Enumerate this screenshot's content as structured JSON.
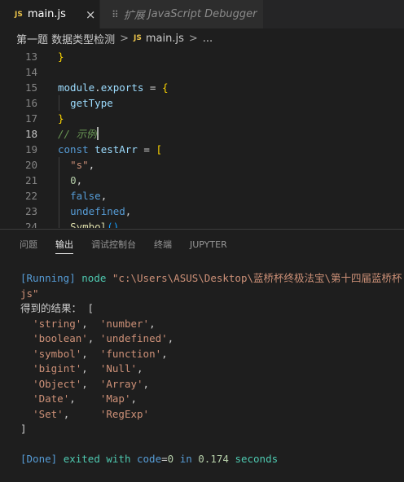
{
  "tabs": {
    "active": {
      "badge": "JS",
      "label": "main.js",
      "close": "×"
    },
    "inactive": {
      "icon": "⠿",
      "prefix": "扩展",
      "label": "JavaScript Debugger"
    }
  },
  "breadcrumb": {
    "folder": "第一题 数据类型检测",
    "sep1": ">",
    "badge": "JS",
    "file": "main.js",
    "sep2": ">",
    "more": "..."
  },
  "editor": {
    "line_numbers": [
      "13",
      "14",
      "15",
      "16",
      "17",
      "18",
      "19",
      "20",
      "21",
      "22",
      "23",
      "24"
    ],
    "current_line": "18",
    "lines": [
      [
        {
          "t": "}",
          "c": "k-brace"
        }
      ],
      [],
      [
        {
          "t": "module",
          "c": "k-var"
        },
        {
          "t": ".",
          "c": "k-punc"
        },
        {
          "t": "exports",
          "c": "k-var"
        },
        {
          "t": " = ",
          "c": "k-punc"
        },
        {
          "t": "{",
          "c": "k-brace"
        }
      ],
      [
        {
          "t": "  ",
          "c": "k-punc"
        },
        {
          "t": "getType",
          "c": "k-var"
        }
      ],
      [
        {
          "t": "}",
          "c": "k-brace"
        }
      ],
      [
        {
          "t": "// 示例",
          "c": "k-cmt"
        }
      ],
      [
        {
          "t": "const",
          "c": "k-kw"
        },
        {
          "t": " ",
          "c": "k-punc"
        },
        {
          "t": "testArr",
          "c": "k-var"
        },
        {
          "t": " = ",
          "c": "k-punc"
        },
        {
          "t": "[",
          "c": "k-brace"
        }
      ],
      [
        {
          "t": "  ",
          "c": "k-punc"
        },
        {
          "t": "\"s\"",
          "c": "k-str"
        },
        {
          "t": ",",
          "c": "k-punc"
        }
      ],
      [
        {
          "t": "  ",
          "c": "k-punc"
        },
        {
          "t": "0",
          "c": "k-num"
        },
        {
          "t": ",",
          "c": "k-punc"
        }
      ],
      [
        {
          "t": "  ",
          "c": "k-punc"
        },
        {
          "t": "false",
          "c": "k-kw"
        },
        {
          "t": ",",
          "c": "k-punc"
        }
      ],
      [
        {
          "t": "  ",
          "c": "k-punc"
        },
        {
          "t": "undefined",
          "c": "k-kw"
        },
        {
          "t": ",",
          "c": "k-punc"
        }
      ],
      [
        {
          "t": "  ",
          "c": "k-punc"
        },
        {
          "t": "Symbol",
          "c": "k-fn"
        },
        {
          "t": "()",
          "c": "k-paren"
        },
        {
          "t": ",",
          "c": "k-punc"
        }
      ]
    ]
  },
  "panel": {
    "tabs": [
      "问题",
      "输出",
      "调试控制台",
      "终端",
      "JUPYTER"
    ],
    "active_tab": "输出"
  },
  "output": {
    "lines": [
      [
        {
          "t": "[Running] ",
          "c": "o-blue"
        },
        {
          "t": "node ",
          "c": "o-green"
        },
        {
          "t": "\"c:\\Users\\ASUS\\Desktop\\蓝桥杯终极法宝\\第十四届蓝桥杯",
          "c": "o-str"
        }
      ],
      [
        {
          "t": "js\"",
          "c": "o-str"
        }
      ],
      [
        {
          "t": "得到的结果： [",
          "c": "o-plain"
        }
      ],
      [
        {
          "t": "  ",
          "c": "o-plain"
        },
        {
          "t": "'string'",
          "c": "o-str"
        },
        {
          "t": ",  ",
          "c": "o-plain"
        },
        {
          "t": "'number'",
          "c": "o-str"
        },
        {
          "t": ",",
          "c": "o-plain"
        }
      ],
      [
        {
          "t": "  ",
          "c": "o-plain"
        },
        {
          "t": "'boolean'",
          "c": "o-str"
        },
        {
          "t": ", ",
          "c": "o-plain"
        },
        {
          "t": "'undefined'",
          "c": "o-str"
        },
        {
          "t": ",",
          "c": "o-plain"
        }
      ],
      [
        {
          "t": "  ",
          "c": "o-plain"
        },
        {
          "t": "'symbol'",
          "c": "o-str"
        },
        {
          "t": ",  ",
          "c": "o-plain"
        },
        {
          "t": "'function'",
          "c": "o-str"
        },
        {
          "t": ",",
          "c": "o-plain"
        }
      ],
      [
        {
          "t": "  ",
          "c": "o-plain"
        },
        {
          "t": "'bigint'",
          "c": "o-str"
        },
        {
          "t": ",  ",
          "c": "o-plain"
        },
        {
          "t": "'Null'",
          "c": "o-str"
        },
        {
          "t": ",",
          "c": "o-plain"
        }
      ],
      [
        {
          "t": "  ",
          "c": "o-plain"
        },
        {
          "t": "'Object'",
          "c": "o-str"
        },
        {
          "t": ",  ",
          "c": "o-plain"
        },
        {
          "t": "'Array'",
          "c": "o-str"
        },
        {
          "t": ",",
          "c": "o-plain"
        }
      ],
      [
        {
          "t": "  ",
          "c": "o-plain"
        },
        {
          "t": "'Date'",
          "c": "o-str"
        },
        {
          "t": ",    ",
          "c": "o-plain"
        },
        {
          "t": "'Map'",
          "c": "o-str"
        },
        {
          "t": ",",
          "c": "o-plain"
        }
      ],
      [
        {
          "t": "  ",
          "c": "o-plain"
        },
        {
          "t": "'Set'",
          "c": "o-str"
        },
        {
          "t": ",     ",
          "c": "o-plain"
        },
        {
          "t": "'RegExp'",
          "c": "o-str"
        }
      ],
      [
        {
          "t": "]",
          "c": "o-plain"
        }
      ],
      [],
      [
        {
          "t": "[Done] ",
          "c": "o-blue"
        },
        {
          "t": "exited with ",
          "c": "o-green"
        },
        {
          "t": "code",
          "c": "o-blue"
        },
        {
          "t": "=",
          "c": "o-plain"
        },
        {
          "t": "0",
          "c": "o-num"
        },
        {
          "t": " in ",
          "c": "o-blue"
        },
        {
          "t": "0.174",
          "c": "o-num"
        },
        {
          "t": " seconds",
          "c": "o-green"
        }
      ]
    ]
  },
  "colors": {
    "background": "#1e1e1e",
    "tabbar": "#252526",
    "accent_js": "#e8c14a"
  }
}
